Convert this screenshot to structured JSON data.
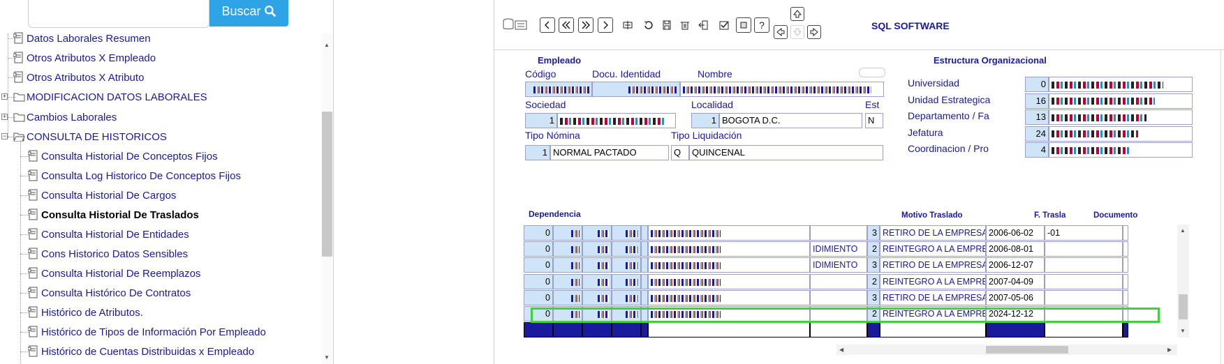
{
  "search": {
    "placeholder": "",
    "button_label": "Buscar"
  },
  "tree": [
    {
      "label": "Datos Laborales Resumen",
      "type": "doc"
    },
    {
      "label": "Otros Atributos X Empleado",
      "type": "doc"
    },
    {
      "label": "Otros Atributos X Atributo",
      "type": "doc"
    },
    {
      "label": "MODIFICACION DATOS LABORALES",
      "type": "folder"
    },
    {
      "label": "Cambios Laborales",
      "type": "folder"
    },
    {
      "label": "CONSULTA DE HISTORICOS",
      "type": "folder-open"
    },
    {
      "label": "Consulta Historial De Conceptos Fijos",
      "type": "doc"
    },
    {
      "label": "Consulta Log Historico De Conceptos Fijos",
      "type": "doc"
    },
    {
      "label": "Consulta Historial De Cargos",
      "type": "doc"
    },
    {
      "label": "Consulta Historial De Traslados",
      "type": "doc",
      "selected": true
    },
    {
      "label": "Consulta Historial De Entidades",
      "type": "doc"
    },
    {
      "label": "Cons Historico Datos Sensibles",
      "type": "doc"
    },
    {
      "label": "Consulta Historial De Reemplazos",
      "type": "doc"
    },
    {
      "label": "Consulta Histórico De Contratos",
      "type": "doc"
    },
    {
      "label": "Histórico de Atributos.",
      "type": "doc"
    },
    {
      "label": "Histórico de Tipos de Información Por Empleado",
      "type": "doc"
    },
    {
      "label": "Histórico de Cuentas Distribuidas x Empleado",
      "type": "doc"
    }
  ],
  "toolbar": {
    "title": "SQL SOFTWARE",
    "icons": [
      "database-search-icon",
      "previous-icon",
      "first-icon",
      "last-icon",
      "next-icon",
      "insert-icon",
      "undo-icon",
      "save-icon",
      "delete-icon",
      "exit-icon",
      "check-icon",
      "print-icon",
      "help-icon",
      "up-icon",
      "left-icon",
      "down-icon",
      "right-icon"
    ]
  },
  "empleado": {
    "heading": "Empleado",
    "codigo_label": "Código",
    "documento_label": "Docu. Identidad",
    "nombre_label": "Nombre",
    "sociedad_label": "Sociedad",
    "sociedad_num": "1",
    "localidad_label": "Localidad",
    "localidad_num": "1",
    "localidad_value": "BOGOTA D.C.",
    "est_label": "Est",
    "est_value": "N",
    "tipo_nomina_label": "Tipo Nómina",
    "tipo_nomina_num": "1",
    "tipo_nomina_value": "NORMAL PACTADO",
    "tipo_liq_label": "Tipo Liquidación",
    "tipo_liq_code": "Q",
    "tipo_liq_value": "QUINCENAL"
  },
  "estructura": {
    "heading": "Estructura Organizacional",
    "rows": [
      {
        "label": "Universidad",
        "num": "0"
      },
      {
        "label": "Unidad Estrategica",
        "num": "16"
      },
      {
        "label": "Departamento / Fa",
        "num": "13"
      },
      {
        "label": "Jefatura",
        "num": "24"
      },
      {
        "label": "Coordinacion / Pro",
        "num": "4"
      }
    ]
  },
  "grid": {
    "headers": {
      "dependencia": "Dependencia",
      "motivo": "Motivo Traslado",
      "fecha": "F. Trasla",
      "documento": "Documento"
    },
    "rows": [
      {
        "n0": "0",
        "mid": "",
        "mnum": "3",
        "motivo": "RETIRO DE LA EMPRESA",
        "fecha": "2006-06-02",
        "doc": "-01"
      },
      {
        "n0": "0",
        "mid": "IDIMIENTO",
        "mnum": "2",
        "motivo": "REINTEGRO A LA EMPRES.",
        "fecha": "2006-08-01",
        "doc": ""
      },
      {
        "n0": "0",
        "mid": "IDIMIENTO",
        "mnum": "3",
        "motivo": "RETIRO DE LA EMPRESA",
        "fecha": "2006-12-07",
        "doc": ""
      },
      {
        "n0": "0",
        "mid": "",
        "mnum": "2",
        "motivo": "REINTEGRO A LA EMPRES.",
        "fecha": "2007-04-09",
        "doc": ""
      },
      {
        "n0": "0",
        "mid": "",
        "mnum": "3",
        "motivo": "RETIRO DE LA EMPRESA",
        "fecha": "2007-05-06",
        "doc": ""
      },
      {
        "n0": "0",
        "mid": "",
        "mnum": "2",
        "motivo": "REINTEGRO A LA EMPRES.",
        "fecha": "2024-12-12",
        "doc": ""
      }
    ]
  },
  "colors": {
    "accent": "#1a1a9c",
    "button": "#2ea3e6",
    "num_cell": "#cfe4f7",
    "highlight": "#3fd13f"
  }
}
